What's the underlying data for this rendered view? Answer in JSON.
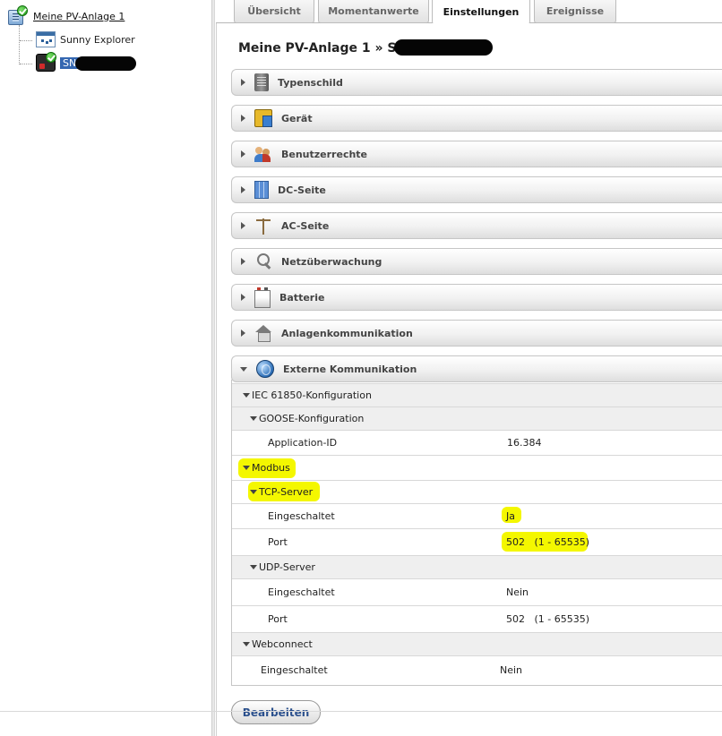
{
  "tree": {
    "root_label": "Meine PV-Anlage 1",
    "children": [
      {
        "label": "Sunny Explorer",
        "icon": "window-icon"
      },
      {
        "label": "SN:",
        "icon": "inverter-icon",
        "selected": true,
        "redacted": true
      }
    ]
  },
  "tabs": [
    {
      "label": "Übersicht",
      "active": false
    },
    {
      "label": "Momentanwerte",
      "active": false
    },
    {
      "label": "Einstellungen",
      "active": true
    },
    {
      "label": "Ereignisse",
      "active": false
    }
  ],
  "page_title": "Meine PV-Anlage 1 » SN:",
  "sections": [
    {
      "label": "Typenschild",
      "icon": "nameplate-icon",
      "open": false
    },
    {
      "label": "Gerät",
      "icon": "device-icon",
      "open": false
    },
    {
      "label": "Benutzerrechte",
      "icon": "users-icon",
      "open": false
    },
    {
      "label": "DC-Seite",
      "icon": "solar-panel-icon",
      "open": false
    },
    {
      "label": "AC-Seite",
      "icon": "power-pole-icon",
      "open": false
    },
    {
      "label": "Netzüberwachung",
      "icon": "grid-monitor-icon",
      "open": false
    },
    {
      "label": "Batterie",
      "icon": "battery-icon",
      "open": false
    },
    {
      "label": "Anlagenkommunikation",
      "icon": "house-signal-icon",
      "open": false
    },
    {
      "label": "Externe Kommunikation",
      "icon": "globe-icon",
      "open": true
    }
  ],
  "external": {
    "iec_label": "IEC 61850-Konfiguration",
    "goose_label": "GOOSE-Konfiguration",
    "application_id_label": "Application-ID",
    "application_id_value": "16.384",
    "modbus_label": "Modbus",
    "tcp_label": "TCP-Server",
    "tcp_enabled_label": "Eingeschaltet",
    "tcp_enabled_value": "Ja",
    "tcp_port_label": "Port",
    "tcp_port_value": "502   (1 - 65535)",
    "udp_label": "UDP-Server",
    "udp_enabled_label": "Eingeschaltet",
    "udp_enabled_value": "Nein",
    "udp_port_label": "Port",
    "udp_port_value": "502   (1 - 65535)",
    "webconnect_label": "Webconnect",
    "webconnect_enabled_label": "Eingeschaltet",
    "webconnect_enabled_value": "Nein"
  },
  "edit_button": "Bearbeiten",
  "colors": {
    "highlight": "#f4f700",
    "tree_selection": "#3467b1",
    "button_text": "#2a4f8c"
  }
}
